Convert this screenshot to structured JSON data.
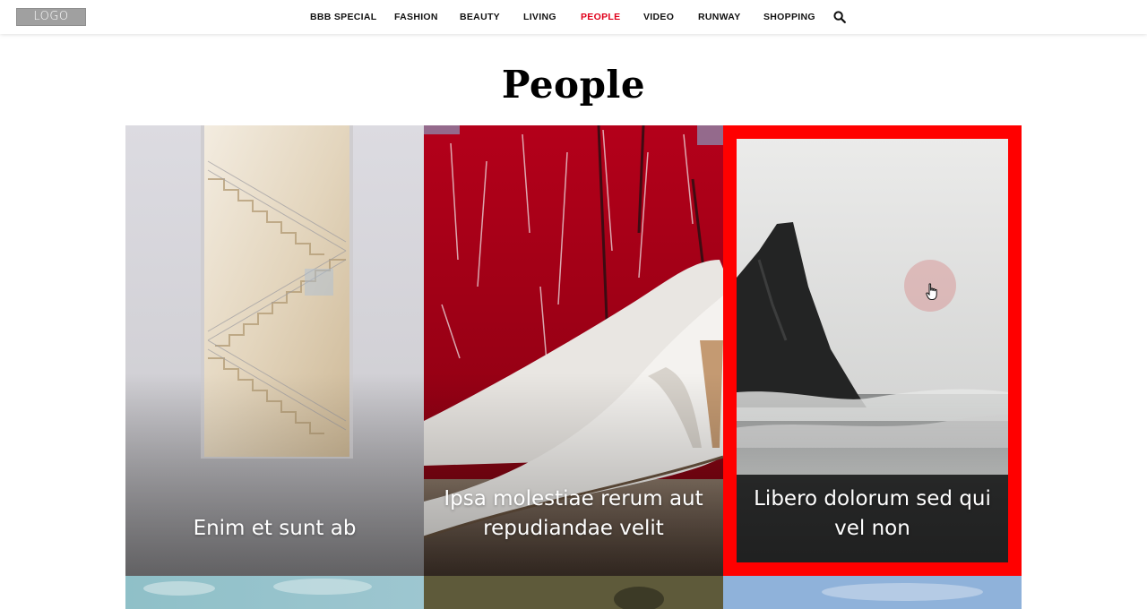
{
  "header": {
    "logo_text": "LOGO",
    "nav": [
      {
        "label": "BBB SPECIAL",
        "active": false
      },
      {
        "label": "FASHION",
        "active": false
      },
      {
        "label": "BEAUTY",
        "active": false
      },
      {
        "label": "LIVING",
        "active": false
      },
      {
        "label": "PEOPLE",
        "active": true
      },
      {
        "label": "VIDEO",
        "active": false
      },
      {
        "label": "RUNWAY",
        "active": false
      },
      {
        "label": "SHOPPING",
        "active": false
      }
    ],
    "search_icon": "search-icon"
  },
  "page": {
    "title": "People"
  },
  "cards": [
    {
      "caption": "Enim et sunt ab",
      "image": "staircase-image"
    },
    {
      "caption": "Ipsa molestiae rerum aut repudiandae velit",
      "image": "white-heels-image"
    },
    {
      "caption": "Libero dolorum sed qui vel non",
      "image": "sea-rock-image",
      "highlighted": true
    }
  ],
  "colors": {
    "accent": "#e0001a",
    "highlight_frame": "#ff0000"
  }
}
